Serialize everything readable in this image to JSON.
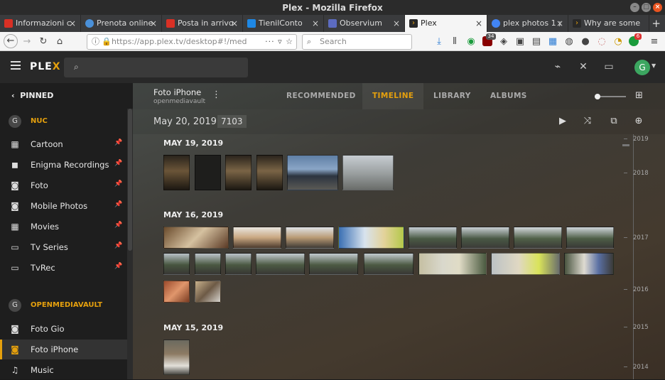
{
  "window": {
    "title": "Plex - Mozilla Firefox"
  },
  "tabs": [
    {
      "label": "Informazioni c",
      "fav_color": "#d93025"
    },
    {
      "label": "Prenota online",
      "fav_color": "#4a90d9"
    },
    {
      "label": "Posta in arrivo",
      "fav_color": "#d93025"
    },
    {
      "label": "TienilConto",
      "fav_color": "#1e88e5"
    },
    {
      "label": "Observium",
      "fav_color": "#5c6bc0"
    },
    {
      "label": "Plex",
      "fav_color": "#282828"
    },
    {
      "label": "plex photos 1 ;",
      "fav_color": "#4285f4"
    },
    {
      "label": "Why are some",
      "fav_color": "#282828"
    }
  ],
  "navbar": {
    "url": "https://app.plex.tv/desktop#!/med",
    "search_placeholder": "Search",
    "badge_34": "34",
    "badge_6": "6"
  },
  "plex": {
    "logo_a": "PLE",
    "logo_b": "X",
    "avatar": "G"
  },
  "sidebar": {
    "pinned_label": "PINNED",
    "servers": [
      {
        "avatar": "G",
        "name": "NUC"
      },
      {
        "avatar": "G",
        "name": "OPENMEDIAVAULT"
      }
    ],
    "items": [
      {
        "label": "Cartoon",
        "icon": "film-icon"
      },
      {
        "label": "Enigma Recordings",
        "icon": "video-camera-icon"
      },
      {
        "label": "Foto",
        "icon": "camera-icon"
      },
      {
        "label": "Mobile Photos",
        "icon": "camera-icon"
      },
      {
        "label": "Movies",
        "icon": "film-icon"
      },
      {
        "label": "Tv Series",
        "icon": "monitor-icon"
      },
      {
        "label": "TvRec",
        "icon": "monitor-icon"
      },
      {
        "label": "Foto Gio",
        "icon": "camera-icon"
      },
      {
        "label": "Foto iPhone",
        "icon": "camera-icon"
      },
      {
        "label": "Music",
        "icon": "music-note-icon"
      }
    ]
  },
  "library": {
    "title": "Foto iPhone",
    "subtitle": "openmediavault",
    "tabs": [
      "RECOMMENDED",
      "TIMELINE",
      "LIBRARY",
      "ALBUMS"
    ],
    "active_tab": "TIMELINE",
    "current_date": "May 20, 2019",
    "count": "7103"
  },
  "sections": [
    {
      "date": "MAY 19, 2019",
      "photos": 6
    },
    {
      "date": "MAY 16, 2019",
      "photos": 19
    },
    {
      "date": "MAY 15, 2019",
      "photos": 1
    }
  ],
  "timeline_years": [
    "2019",
    "2018",
    "2017",
    "2016",
    "2015",
    "2014"
  ],
  "colors": {
    "accent": "#e5a00d",
    "sidebar_bg": "#1e1e1e",
    "header_bg": "#282828"
  }
}
